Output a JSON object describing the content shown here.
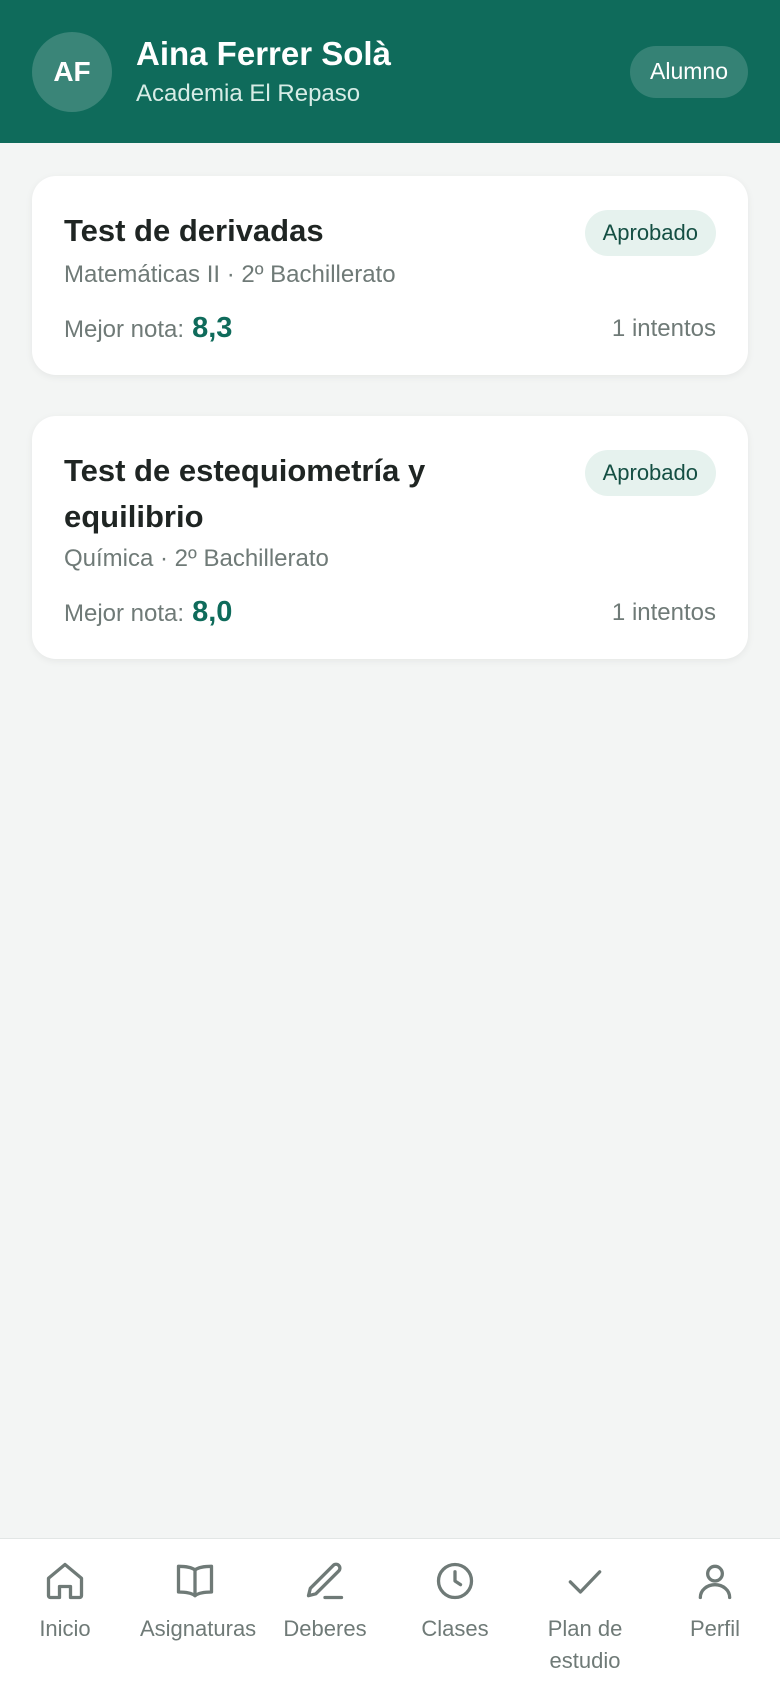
{
  "header": {
    "avatar_initials": "AF",
    "user_name": "Aina Ferrer Solà",
    "academy": "Academia El Repaso",
    "role": "Alumno"
  },
  "tests": [
    {
      "title": "Test de derivadas",
      "status": "Aprobado",
      "subtitle": "Matemáticas II · 2º Bachillerato",
      "best_label": "Mejor nota:",
      "best_value": "8,3",
      "attempts": "1 intentos"
    },
    {
      "title": "Test de estequiometría y equilibrio",
      "status": "Aprobado",
      "subtitle": "Química · 2º Bachillerato",
      "best_label": "Mejor nota:",
      "best_value": "8,0",
      "attempts": "1 intentos"
    }
  ],
  "nav": {
    "items": [
      {
        "label": "Inicio",
        "icon": "home-icon"
      },
      {
        "label": "Asignaturas",
        "icon": "book-icon"
      },
      {
        "label": "Deberes",
        "icon": "pencil-icon"
      },
      {
        "label": "Clases",
        "icon": "clock-icon"
      },
      {
        "label": "Plan de estudio",
        "icon": "check-icon"
      },
      {
        "label": "Perfil",
        "icon": "user-icon"
      }
    ]
  },
  "colors": {
    "brand": "#0f6b5b",
    "background": "#f3f5f4",
    "badge_bg": "#e6f2ee",
    "muted_text": "#6f7a77"
  }
}
